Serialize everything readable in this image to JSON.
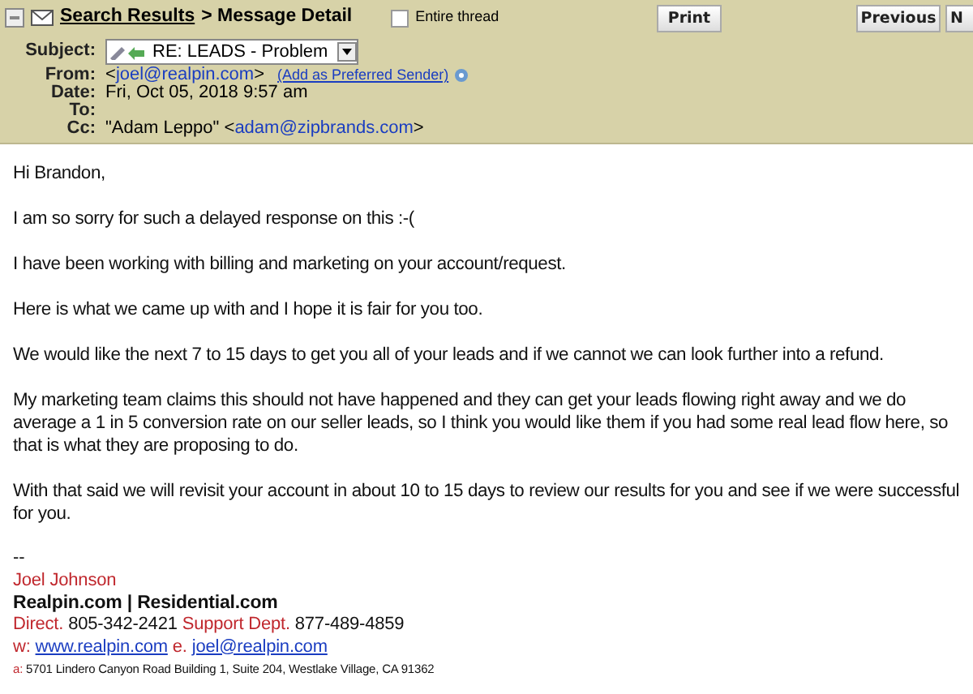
{
  "header": {
    "breadcrumb_link": "Search Results",
    "breadcrumb_current": "> Message Detail",
    "entire_thread": {
      "label": "Entire thread",
      "checked": false
    },
    "buttons": [
      "Print",
      "Previous",
      "N"
    ]
  },
  "fields": [
    {
      "kind": "select",
      "label": "Subject:",
      "value": "RE: LEADS - Problem"
    },
    {
      "kind": "sender",
      "label": "From:",
      "prefix": "<",
      "email": "joel@realpin.com",
      "suffix": ">",
      "action": "(Add as Preferred Sender)"
    },
    {
      "kind": "text",
      "label": "Date:",
      "value": "Fri, Oct 05, 2018 9:57 am"
    },
    {
      "kind": "empty",
      "label": "To:"
    },
    {
      "kind": "contact",
      "label": "Cc:",
      "name": "\"Adam Leppo\"",
      "prefix": "<",
      "email": "adam@zipbrands.com",
      "suffix": ">"
    }
  ],
  "body": [
    "Hi Brandon,",
    "I am so sorry for such a delayed response on this :-(",
    "I have been working with billing and marketing on your account/request.",
    "Here is what we came up with and I hope it is fair for you too.",
    "We would like the next 7 to 15 days to get you all of your leads and if we cannot we can look further into a refund.",
    "My marketing team claims this should not have happened and they can get your leads flowing right away and we do average a 1 in 5 conversion rate on our seller leads, so I think you would like them if you had some real lead flow here, so that is what they are proposing to do.",
    "With that said we will revisit your account in about 10 to 15 days to review our results for you and see if we were successful for you."
  ],
  "signature": {
    "separator": "--",
    "name": "Joel Johnson",
    "company": "Realpin.com | Residential.com",
    "phones": [
      {
        "label": "Direct.",
        "value": "805-342-2421"
      },
      {
        "label": "Support Dept.",
        "value": "877-489-4859"
      }
    ],
    "links": [
      {
        "label": "w:",
        "value": "www.realpin.com"
      },
      {
        "label": "e.",
        "value": "joel@realpin.com"
      }
    ],
    "address": {
      "label": "a:",
      "value": "5701 Lindero Canyon Road Building 1, Suite 204, Westlake Village, CA 91362"
    }
  }
}
